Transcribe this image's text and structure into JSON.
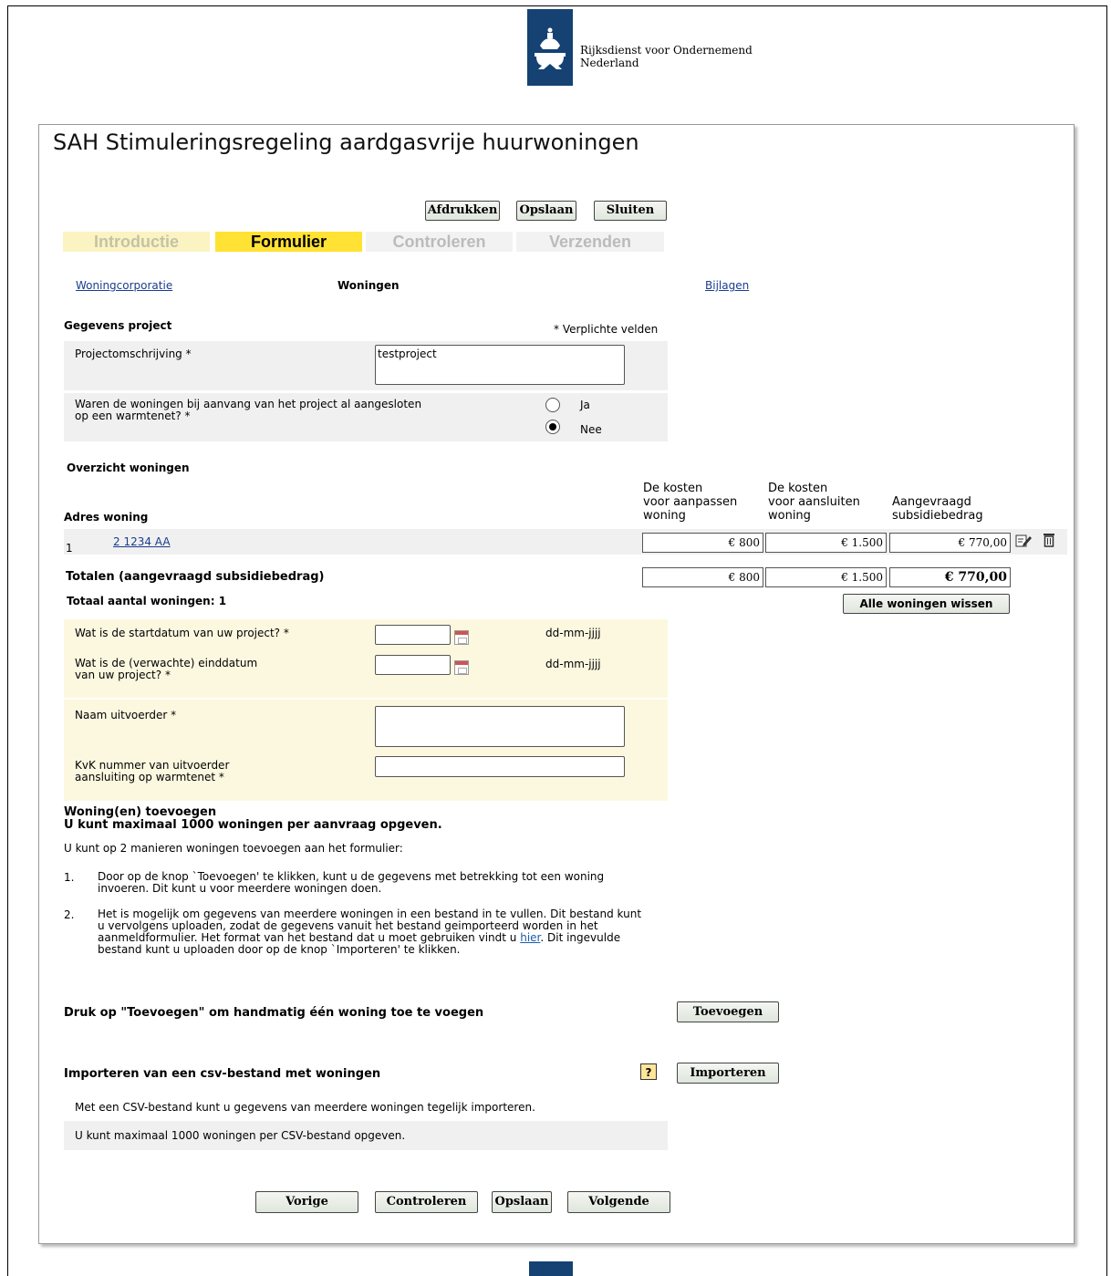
{
  "header": {
    "org_name_line1": "Rijksdienst voor Ondernemend",
    "org_name_line2": "Nederland"
  },
  "page_title": "SAH Stimuleringsregeling aardgasvrije huurwoningen",
  "toolbar": {
    "print": "Afdrukken",
    "save": "Opslaan",
    "close": "Sluiten"
  },
  "steps": [
    "Introductie",
    "Formulier",
    "Controleren",
    "Verzenden"
  ],
  "subnav": {
    "corporatie": "Woningcorporatie",
    "woningen": "Woningen",
    "bijlagen": "Bijlagen"
  },
  "project": {
    "heading": "Gegevens project",
    "required_note": "* Verplichte velden",
    "description_label": "Projectomschrijving *",
    "description_value": "testproject",
    "warmtenet_question_line1": "Waren de woningen bij aanvang van het project al aangesloten",
    "warmtenet_question_line2": "op een warmtenet? *",
    "option_yes": "Ja",
    "option_no": "Nee",
    "selected": "Nee"
  },
  "overview": {
    "heading": "Overzicht woningen",
    "col_address": "Adres woning",
    "col_cost_adjust": [
      "De kosten",
      "voor aanpassen",
      "woning"
    ],
    "col_cost_connect": [
      "De kosten",
      "voor aansluiten",
      "woning"
    ],
    "col_requested": [
      "Aangevraagd",
      "subsidiebedrag"
    ],
    "rows": [
      {
        "index": "1",
        "address": "2 1234 AA",
        "cost_adjust": "€ 800",
        "cost_connect": "€ 1.500",
        "requested": "€ 770,00"
      }
    ],
    "totals_label": "Totalen (aangevraagd subsidiebedrag)",
    "total_adjust": "€ 800",
    "total_connect": "€ 1.500",
    "total_requested": "€ 770,00",
    "count_label": "Totaal aantal woningen: 1",
    "clear_all": "Alle woningen wissen"
  },
  "dates": {
    "start_label": "Wat is de startdatum van uw project? *",
    "end_label_line1": "Wat is de (verwachte) einddatum",
    "end_label_line2": "van uw project? *",
    "format": "dd-mm-jjjj"
  },
  "contractor": {
    "name_label": "Naam uitvoerder *",
    "kvk_label_line1": "KvK nummer van uitvoerder",
    "kvk_label_line2": "aansluiting op warmtenet *"
  },
  "add": {
    "heading1": "Woning(en) toevoegen",
    "heading2": "U kunt maximaal 1000 woningen per aanvraag opgeven.",
    "intro": "U kunt op 2 manieren woningen toevoegen aan het formulier:",
    "item1_num": "1.",
    "item1_line1": "Door op de knop `Toevoegen' te klikken, kunt u de gegevens met betrekking tot een woning",
    "item1_line2": "invoeren. Dit kunt u voor meerdere woningen doen.",
    "item2_num": "2.",
    "item2_line1": "Het is mogelijk om gegevens van meerdere woningen in een bestand in te vullen. Dit bestand kunt",
    "item2_line2": "u vervolgens uploaden, zodat de gegevens vanuit het bestand geimporteerd worden in het",
    "item2_line3": "aanmeldformulier. Het format van het bestand dat u moet gebruiken vindt u",
    "item2_link": "hier",
    "item2_line3_after": ". Dit ingevulde",
    "item2_line4": "bestand kunt u uploaden door op de knop `Importeren' te klikken.",
    "manual_label": "Druk op \"Toevoegen\" om handmatig één woning toe te voegen",
    "manual_button": "Toevoegen",
    "import_label": "Importeren van een csv-bestand met woningen",
    "help": "?",
    "import_button": "Importeren",
    "import_note1": "Met een CSV-bestand kunt u gegevens van meerdere woningen tegelijk importeren.",
    "import_note2": "U kunt maximaal 1000 woningen per CSV-bestand opgeven."
  },
  "footer_buttons": {
    "prev": "Vorige",
    "check": "Controleren",
    "save": "Opslaan",
    "next": "Volgende"
  }
}
